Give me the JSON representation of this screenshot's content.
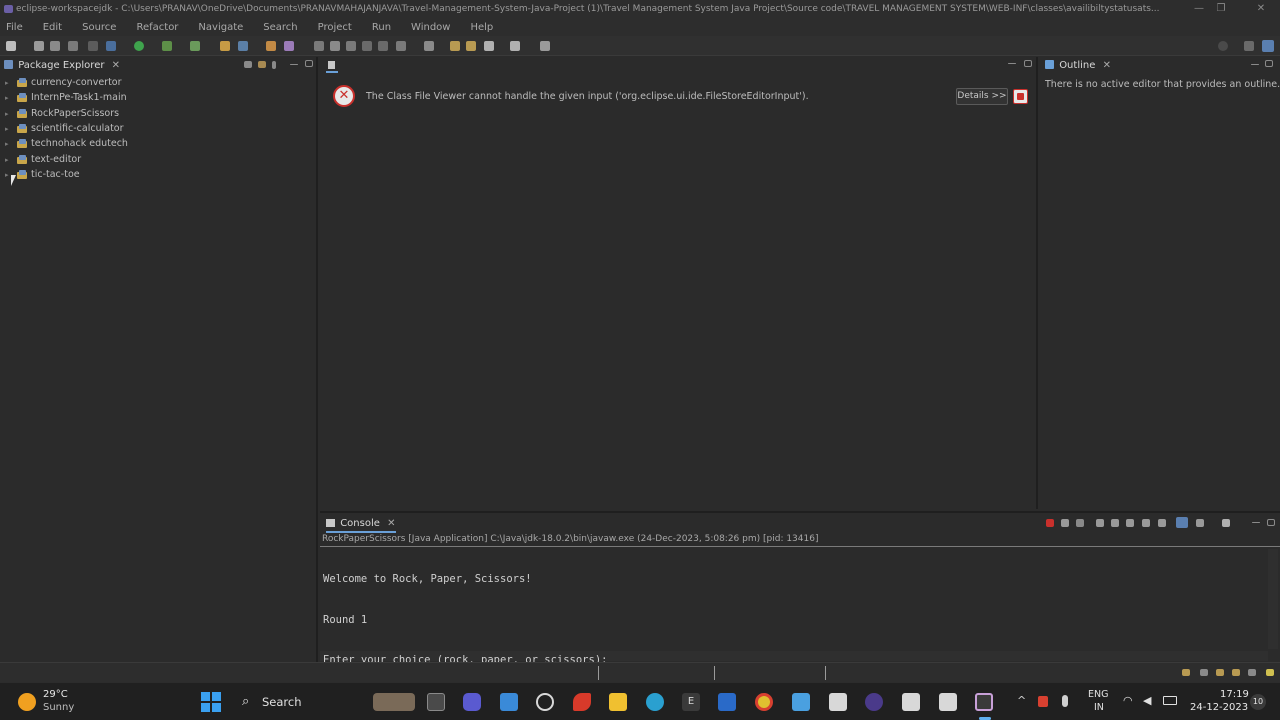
{
  "window": {
    "title": "eclipse-workspacejdk - C:\\Users\\PRANAV\\OneDrive\\Documents\\PRANAVMAHAJANJAVA\\Travel-Management-System-Java-Project (1)\\Travel Management System Java Project\\Source code\\TRAVEL MANAGEMENT SYSTEM\\WEB-INF\\classes\\availibiltystatusats...",
    "min_glyph": "—",
    "max_glyph": "❐",
    "close_glyph": "✕"
  },
  "menu": [
    "File",
    "Edit",
    "Source",
    "Refactor",
    "Navigate",
    "Search",
    "Project",
    "Run",
    "Window",
    "Help"
  ],
  "package_explorer": {
    "title": "Package Explorer",
    "items": [
      "currency-convertor",
      "InternPe-Task1-main",
      "RockPaperScissors",
      "scientific-calculator",
      "technohack edutech",
      "text-editor",
      "tic-tac-toe"
    ]
  },
  "editor": {
    "error_message": "The Class File Viewer cannot handle the given input ('org.eclipse.ui.ide.FileStoreEditorInput').",
    "details_label": "Details >>"
  },
  "outline": {
    "title": "Outline",
    "message": "There is no active editor that provides an outline."
  },
  "console": {
    "title": "Console",
    "launch_info": "RockPaperScissors [Java Application] C:\\Java\\jdk-18.0.2\\bin\\javaw.exe  (24-Dec-2023, 5:08:26 pm) [pid: 13416]",
    "lines": [
      "Welcome to Rock, Paper, Scissors!",
      "Round 1",
      "Enter your choice (rock, paper, or scissors):"
    ]
  },
  "taskbar": {
    "weather_temp": "29°C",
    "weather_desc": "Sunny",
    "search_label": "Search",
    "lang_top": "ENG",
    "lang_bottom": "IN",
    "time": "17:19",
    "date": "24-12-2023",
    "notif_count": "10"
  },
  "colors": {
    "background": "#2b2b2b",
    "error_red": "#c9302c",
    "taskbar": "#202020"
  }
}
